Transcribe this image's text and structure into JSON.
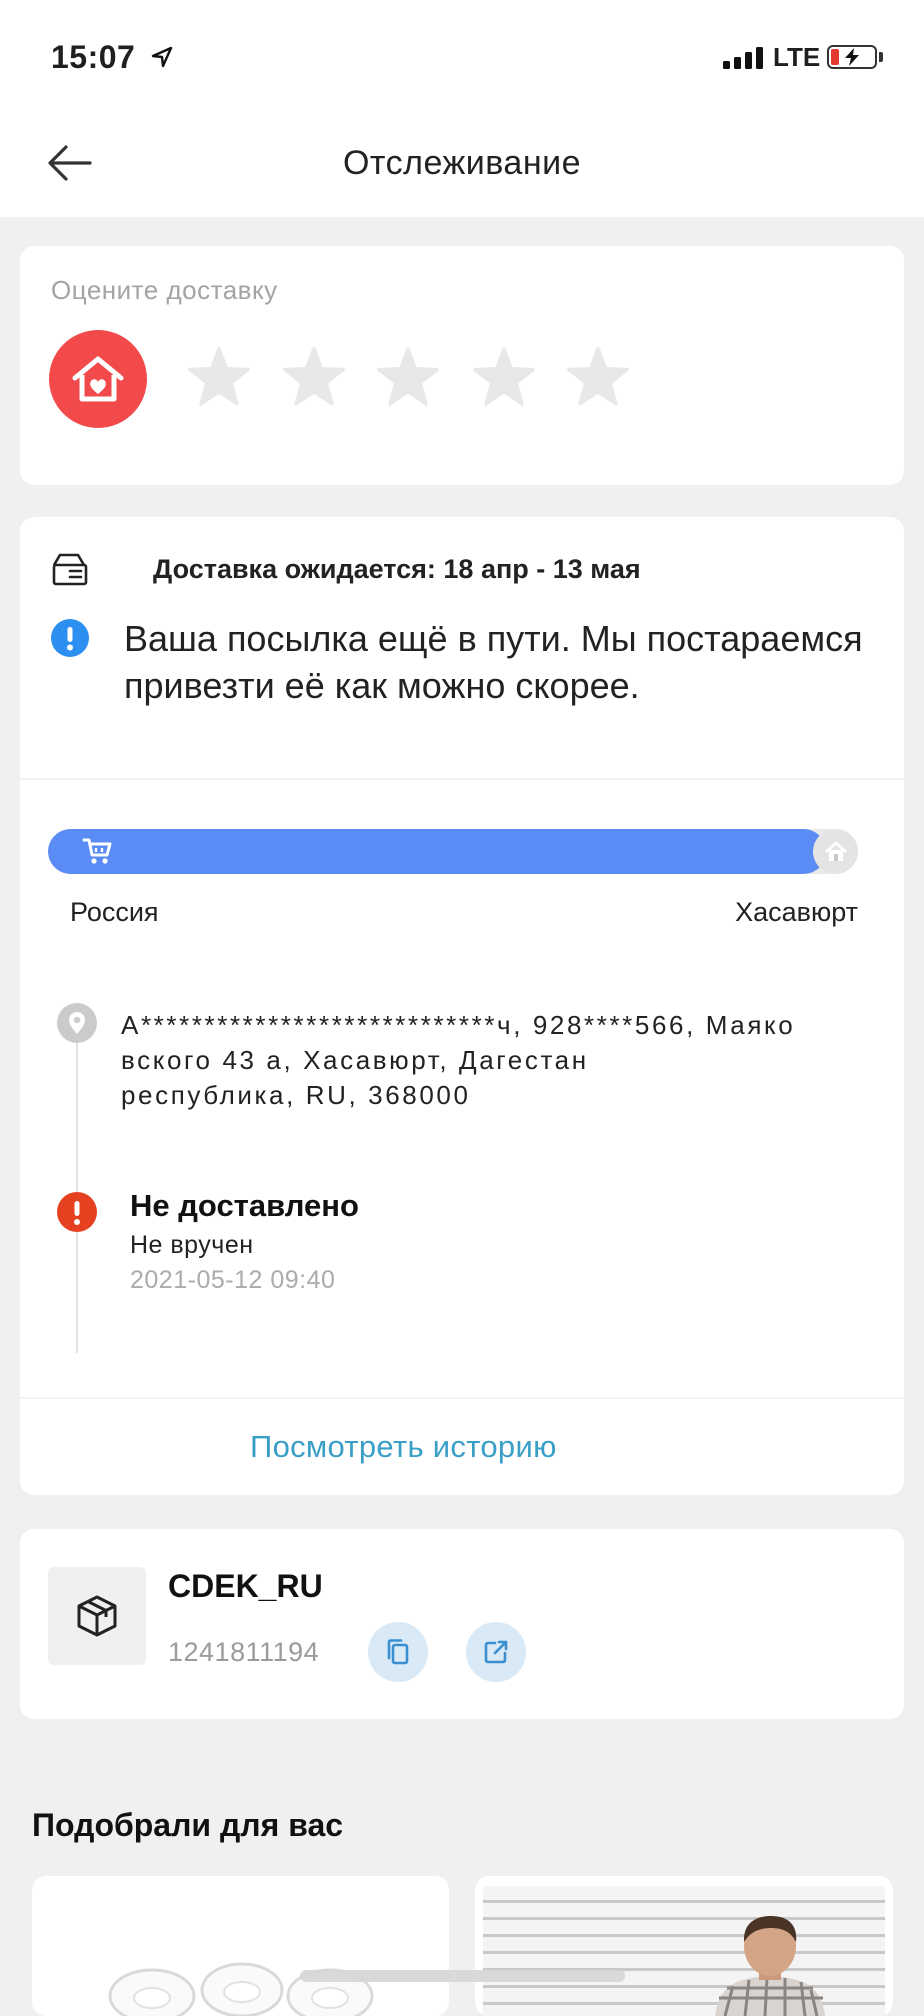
{
  "status_bar": {
    "time": "15:07",
    "network": "LTE",
    "battery_fraction": 0.2
  },
  "header": {
    "title": "Отслеживание"
  },
  "rating": {
    "label": "Оцените доставку",
    "stars_total": 5,
    "stars_selected": 0
  },
  "delivery": {
    "expected": "Доставка ожидается: 18 апр - 13 мая",
    "message": "Ваша посылка ещё в пути. Мы постараемся привезти её как можно скорее.",
    "progress_fraction": 0.96,
    "origin": "Россия",
    "destination": "Хасавюрт",
    "address_lines": [
      "А****************************ч, 928****566, Маяко",
      "вского 43 а, Хасавюрт, Дагестан",
      "республика, RU, 368000"
    ],
    "last_event": {
      "title": "Не доставлено",
      "detail": "Не вручен",
      "timestamp": "2021-05-12 09:40"
    },
    "history_link": "Посмотреть историю"
  },
  "carrier": {
    "name": "CDEK_RU",
    "tracking_number": "1241811194"
  },
  "recommendations": {
    "title": "Подобрали для вас"
  },
  "icons": {
    "back": "arrow-left-icon",
    "location_services": "location-arrow-icon",
    "rating": "house-heart-icon",
    "star": "star-icon",
    "delivery_estimate": "package-icon",
    "info": "info-icon",
    "cart": "cart-icon",
    "destination": "house-icon",
    "address": "map-pin-icon",
    "alert": "exclamation-icon",
    "carrier": "cube-icon",
    "copy": "copy-icon",
    "open": "external-link-icon"
  },
  "colors": {
    "background": "#f0f0f0",
    "rating_red": "#f24a4a",
    "progress_blue": "#5b8cf5",
    "info_blue": "#2d8ff0",
    "alert_red": "#e5401f",
    "link": "#3a9fc7",
    "button_bg": "#d9e9f5"
  }
}
